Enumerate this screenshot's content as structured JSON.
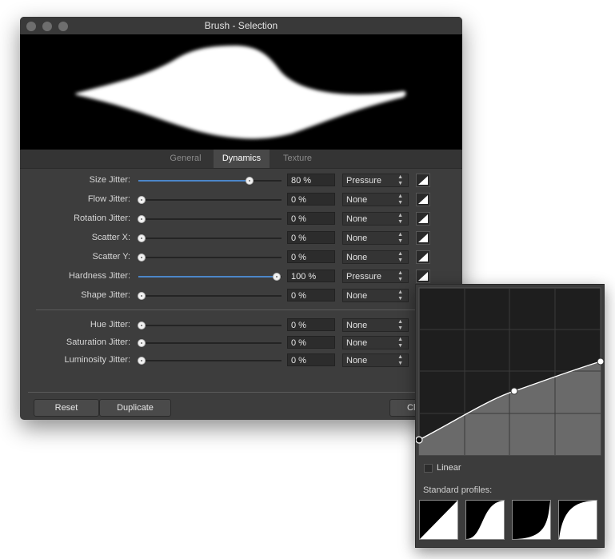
{
  "window": {
    "title": "Brush - Selection",
    "tabs": [
      {
        "label": "General",
        "active": false
      },
      {
        "label": "Dynamics",
        "active": true
      },
      {
        "label": "Texture",
        "active": false
      }
    ],
    "jitter_rows": [
      {
        "label": "Size Jitter:",
        "value_text": "80 %",
        "level": 0.8,
        "controller": "Pressure"
      },
      {
        "label": "Flow Jitter:",
        "value_text": "0 %",
        "level": 0,
        "controller": "None"
      },
      {
        "label": "Rotation Jitter:",
        "value_text": "0 %",
        "level": 0,
        "controller": "None"
      },
      {
        "label": "Scatter X:",
        "value_text": "0 %",
        "level": 0,
        "controller": "None"
      },
      {
        "label": "Scatter Y:",
        "value_text": "0 %",
        "level": 0,
        "controller": "None"
      },
      {
        "label": "Hardness Jitter:",
        "value_text": "100 %",
        "level": 1,
        "controller": "Pressure"
      },
      {
        "label": "Shape Jitter:",
        "value_text": "0 %",
        "level": 0,
        "controller": "None"
      }
    ],
    "color_rows": [
      {
        "label": "Hue Jitter:",
        "value_text": "0 %",
        "level": 0,
        "controller": "None"
      },
      {
        "label": "Saturation Jitter:",
        "value_text": "0 %",
        "level": 0,
        "controller": "None"
      },
      {
        "label": "Luminosity Jitter:",
        "value_text": "0 %",
        "level": 0,
        "controller": "None"
      }
    ],
    "buttons": {
      "reset": "Reset",
      "duplicate": "Duplicate",
      "close": "Cl"
    }
  },
  "curve_popover": {
    "linear_label": "Linear",
    "linear_checked": false,
    "standard_profiles_label": "Standard profiles:"
  }
}
